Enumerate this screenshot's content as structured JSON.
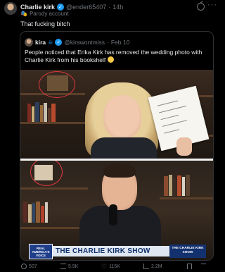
{
  "post": {
    "author_name": "Charlie kirk",
    "author_handle": "@ender65407",
    "time": "14h",
    "label": "Parody account",
    "text": "That fucking bitch",
    "more_label": "···"
  },
  "quote": {
    "author_name": "kira",
    "author_handle": "@kirawontmiss",
    "date": "Feb 10",
    "text": "People noticed that Erika Kirk has removed the wedding photo with Charlie Kirk from his bookshelf"
  },
  "video": {
    "show_title": "THE CHARLIE KIRK SHOW",
    "channel_logo": "REAL AMERICA'S VOICE",
    "show_logo": "THE CHARLIE KIRK SHOW"
  },
  "actions": {
    "replies": "507",
    "reposts": "5.5K",
    "likes": "115K",
    "views": "2.2M"
  },
  "colors": {
    "accent": "#1d9bf0",
    "background": "#000000",
    "circle_highlight": "#e0383e"
  }
}
